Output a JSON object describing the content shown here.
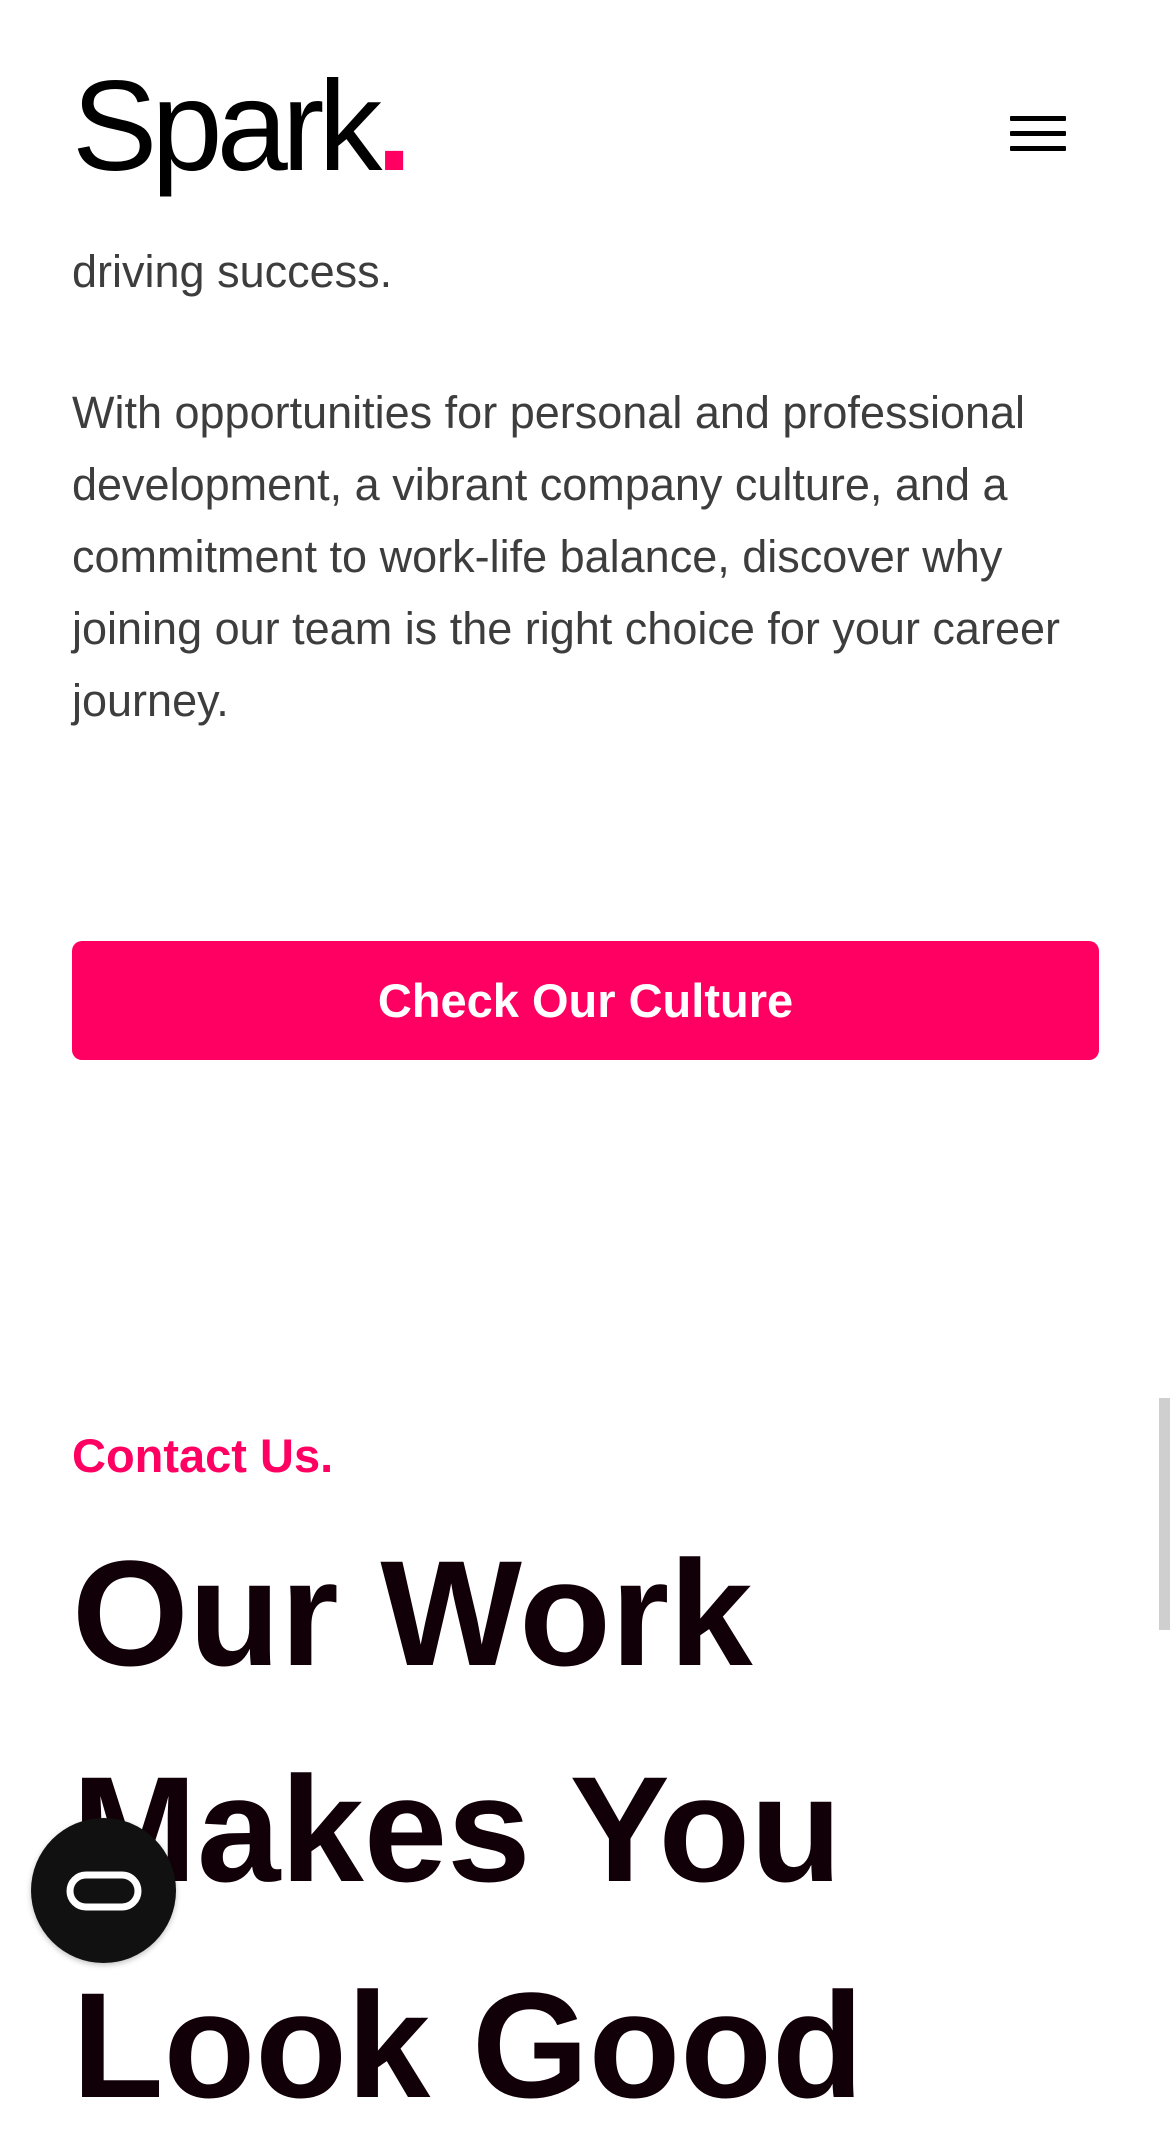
{
  "header": {
    "logo_text": "Spark",
    "logo_dot": ".",
    "menu_icon": "hamburger-menu-icon"
  },
  "intro": {
    "clipped_line": "driving success.",
    "paragraph": "With opportunities for personal and professional development, a vibrant company culture, and a commitment to work-life balance, discover why joining our team is the right choice for your career journey."
  },
  "cta": {
    "label": "Check Our Culture"
  },
  "contact": {
    "eyebrow": "Contact Us.",
    "headline": "Our Work Makes You Look Good"
  },
  "chat_widget": {
    "icon": "chat-bubble-icon"
  },
  "colors": {
    "accent": "#ff0062",
    "heading": "#120008",
    "body_text": "#3d3d3d",
    "widget_bg": "#111111"
  }
}
